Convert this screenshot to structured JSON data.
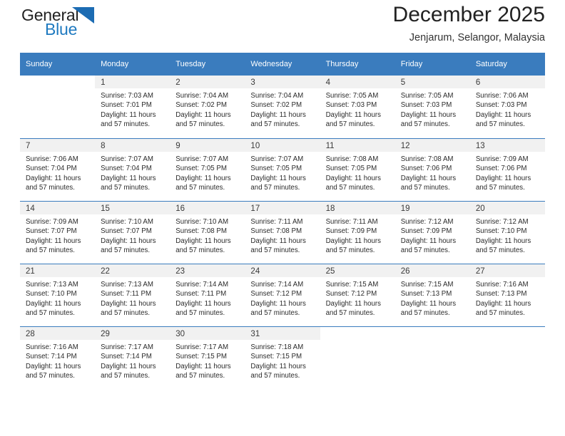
{
  "brand": {
    "name_part1": "General",
    "name_part2": "Blue",
    "triangle_color": "#1c6cb3",
    "blue_text_color": "#1f7ac0"
  },
  "header": {
    "title": "December 2025",
    "location": "Jenjarum, Selangor, Malaysia"
  },
  "calendar": {
    "header_bg": "#3a7cbe",
    "daynum_bg": "#f1f1f1",
    "weekday_headers": [
      "Sunday",
      "Monday",
      "Tuesday",
      "Wednesday",
      "Thursday",
      "Friday",
      "Saturday"
    ],
    "labels": {
      "sunrise_prefix": "Sunrise:",
      "sunset_prefix": "Sunset:",
      "daylight_prefix": "Daylight:"
    },
    "weeks": [
      [
        {
          "day": "",
          "sunrise": "",
          "sunset": "",
          "daylight_line1": "",
          "daylight_line2": ""
        },
        {
          "day": "1",
          "sunrise": "Sunrise: 7:03 AM",
          "sunset": "Sunset: 7:01 PM",
          "daylight_line1": "Daylight: 11 hours",
          "daylight_line2": "and 57 minutes."
        },
        {
          "day": "2",
          "sunrise": "Sunrise: 7:04 AM",
          "sunset": "Sunset: 7:02 PM",
          "daylight_line1": "Daylight: 11 hours",
          "daylight_line2": "and 57 minutes."
        },
        {
          "day": "3",
          "sunrise": "Sunrise: 7:04 AM",
          "sunset": "Sunset: 7:02 PM",
          "daylight_line1": "Daylight: 11 hours",
          "daylight_line2": "and 57 minutes."
        },
        {
          "day": "4",
          "sunrise": "Sunrise: 7:05 AM",
          "sunset": "Sunset: 7:03 PM",
          "daylight_line1": "Daylight: 11 hours",
          "daylight_line2": "and 57 minutes."
        },
        {
          "day": "5",
          "sunrise": "Sunrise: 7:05 AM",
          "sunset": "Sunset: 7:03 PM",
          "daylight_line1": "Daylight: 11 hours",
          "daylight_line2": "and 57 minutes."
        },
        {
          "day": "6",
          "sunrise": "Sunrise: 7:06 AM",
          "sunset": "Sunset: 7:03 PM",
          "daylight_line1": "Daylight: 11 hours",
          "daylight_line2": "and 57 minutes."
        }
      ],
      [
        {
          "day": "7",
          "sunrise": "Sunrise: 7:06 AM",
          "sunset": "Sunset: 7:04 PM",
          "daylight_line1": "Daylight: 11 hours",
          "daylight_line2": "and 57 minutes."
        },
        {
          "day": "8",
          "sunrise": "Sunrise: 7:07 AM",
          "sunset": "Sunset: 7:04 PM",
          "daylight_line1": "Daylight: 11 hours",
          "daylight_line2": "and 57 minutes."
        },
        {
          "day": "9",
          "sunrise": "Sunrise: 7:07 AM",
          "sunset": "Sunset: 7:05 PM",
          "daylight_line1": "Daylight: 11 hours",
          "daylight_line2": "and 57 minutes."
        },
        {
          "day": "10",
          "sunrise": "Sunrise: 7:07 AM",
          "sunset": "Sunset: 7:05 PM",
          "daylight_line1": "Daylight: 11 hours",
          "daylight_line2": "and 57 minutes."
        },
        {
          "day": "11",
          "sunrise": "Sunrise: 7:08 AM",
          "sunset": "Sunset: 7:05 PM",
          "daylight_line1": "Daylight: 11 hours",
          "daylight_line2": "and 57 minutes."
        },
        {
          "day": "12",
          "sunrise": "Sunrise: 7:08 AM",
          "sunset": "Sunset: 7:06 PM",
          "daylight_line1": "Daylight: 11 hours",
          "daylight_line2": "and 57 minutes."
        },
        {
          "day": "13",
          "sunrise": "Sunrise: 7:09 AM",
          "sunset": "Sunset: 7:06 PM",
          "daylight_line1": "Daylight: 11 hours",
          "daylight_line2": "and 57 minutes."
        }
      ],
      [
        {
          "day": "14",
          "sunrise": "Sunrise: 7:09 AM",
          "sunset": "Sunset: 7:07 PM",
          "daylight_line1": "Daylight: 11 hours",
          "daylight_line2": "and 57 minutes."
        },
        {
          "day": "15",
          "sunrise": "Sunrise: 7:10 AM",
          "sunset": "Sunset: 7:07 PM",
          "daylight_line1": "Daylight: 11 hours",
          "daylight_line2": "and 57 minutes."
        },
        {
          "day": "16",
          "sunrise": "Sunrise: 7:10 AM",
          "sunset": "Sunset: 7:08 PM",
          "daylight_line1": "Daylight: 11 hours",
          "daylight_line2": "and 57 minutes."
        },
        {
          "day": "17",
          "sunrise": "Sunrise: 7:11 AM",
          "sunset": "Sunset: 7:08 PM",
          "daylight_line1": "Daylight: 11 hours",
          "daylight_line2": "and 57 minutes."
        },
        {
          "day": "18",
          "sunrise": "Sunrise: 7:11 AM",
          "sunset": "Sunset: 7:09 PM",
          "daylight_line1": "Daylight: 11 hours",
          "daylight_line2": "and 57 minutes."
        },
        {
          "day": "19",
          "sunrise": "Sunrise: 7:12 AM",
          "sunset": "Sunset: 7:09 PM",
          "daylight_line1": "Daylight: 11 hours",
          "daylight_line2": "and 57 minutes."
        },
        {
          "day": "20",
          "sunrise": "Sunrise: 7:12 AM",
          "sunset": "Sunset: 7:10 PM",
          "daylight_line1": "Daylight: 11 hours",
          "daylight_line2": "and 57 minutes."
        }
      ],
      [
        {
          "day": "21",
          "sunrise": "Sunrise: 7:13 AM",
          "sunset": "Sunset: 7:10 PM",
          "daylight_line1": "Daylight: 11 hours",
          "daylight_line2": "and 57 minutes."
        },
        {
          "day": "22",
          "sunrise": "Sunrise: 7:13 AM",
          "sunset": "Sunset: 7:11 PM",
          "daylight_line1": "Daylight: 11 hours",
          "daylight_line2": "and 57 minutes."
        },
        {
          "day": "23",
          "sunrise": "Sunrise: 7:14 AM",
          "sunset": "Sunset: 7:11 PM",
          "daylight_line1": "Daylight: 11 hours",
          "daylight_line2": "and 57 minutes."
        },
        {
          "day": "24",
          "sunrise": "Sunrise: 7:14 AM",
          "sunset": "Sunset: 7:12 PM",
          "daylight_line1": "Daylight: 11 hours",
          "daylight_line2": "and 57 minutes."
        },
        {
          "day": "25",
          "sunrise": "Sunrise: 7:15 AM",
          "sunset": "Sunset: 7:12 PM",
          "daylight_line1": "Daylight: 11 hours",
          "daylight_line2": "and 57 minutes."
        },
        {
          "day": "26",
          "sunrise": "Sunrise: 7:15 AM",
          "sunset": "Sunset: 7:13 PM",
          "daylight_line1": "Daylight: 11 hours",
          "daylight_line2": "and 57 minutes."
        },
        {
          "day": "27",
          "sunrise": "Sunrise: 7:16 AM",
          "sunset": "Sunset: 7:13 PM",
          "daylight_line1": "Daylight: 11 hours",
          "daylight_line2": "and 57 minutes."
        }
      ],
      [
        {
          "day": "28",
          "sunrise": "Sunrise: 7:16 AM",
          "sunset": "Sunset: 7:14 PM",
          "daylight_line1": "Daylight: 11 hours",
          "daylight_line2": "and 57 minutes."
        },
        {
          "day": "29",
          "sunrise": "Sunrise: 7:17 AM",
          "sunset": "Sunset: 7:14 PM",
          "daylight_line1": "Daylight: 11 hours",
          "daylight_line2": "and 57 minutes."
        },
        {
          "day": "30",
          "sunrise": "Sunrise: 7:17 AM",
          "sunset": "Sunset: 7:15 PM",
          "daylight_line1": "Daylight: 11 hours",
          "daylight_line2": "and 57 minutes."
        },
        {
          "day": "31",
          "sunrise": "Sunrise: 7:18 AM",
          "sunset": "Sunset: 7:15 PM",
          "daylight_line1": "Daylight: 11 hours",
          "daylight_line2": "and 57 minutes."
        },
        {
          "day": "",
          "sunrise": "",
          "sunset": "",
          "daylight_line1": "",
          "daylight_line2": ""
        },
        {
          "day": "",
          "sunrise": "",
          "sunset": "",
          "daylight_line1": "",
          "daylight_line2": ""
        },
        {
          "day": "",
          "sunrise": "",
          "sunset": "",
          "daylight_line1": "",
          "daylight_line2": ""
        }
      ]
    ]
  }
}
